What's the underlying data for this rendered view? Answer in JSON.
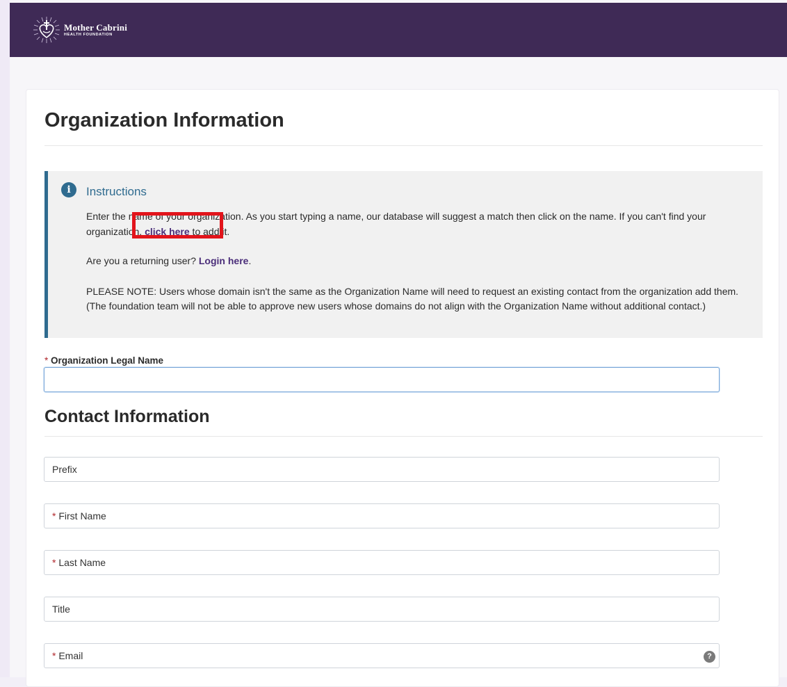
{
  "header": {
    "logo_name": "Mother Cabrini",
    "logo_sub": "HEALTH FOUNDATION"
  },
  "org_section": {
    "title": "Organization Information",
    "instructions": {
      "title": "Instructions",
      "line1_pre": "Enter the name of your organization. As you start typing a name, our database will suggest a match then click on the name. If you can't find your organization, ",
      "line1_link": "click here",
      "line1_post": " to add it.",
      "line2_pre": "Are you a returning user? ",
      "line2_link": "Login here",
      "line2_post": ".",
      "note": "PLEASE NOTE: Users whose domain isn't the same as the Organization Name will need to request an existing contact from the organization add them. (The foundation team will not be able to approve new users whose domains do not align with the Organization Name without additional contact.)"
    },
    "legal_name_label": "Organization Legal Name",
    "legal_name_value": ""
  },
  "contact_section": {
    "title": "Contact Information",
    "fields": [
      {
        "label": "Prefix",
        "required": false
      },
      {
        "label": "First Name",
        "required": true
      },
      {
        "label": "Last Name",
        "required": true
      },
      {
        "label": "Title",
        "required": false
      },
      {
        "label": "Email",
        "required": true
      }
    ]
  },
  "required_marker": "*",
  "help_glyph": "?",
  "colors": {
    "header_bg": "#3f2a56",
    "accent_blue": "#2f6b8f",
    "link_purple": "#4b2e7a",
    "required_red": "#b0262b",
    "highlight_red": "#e2141b"
  }
}
